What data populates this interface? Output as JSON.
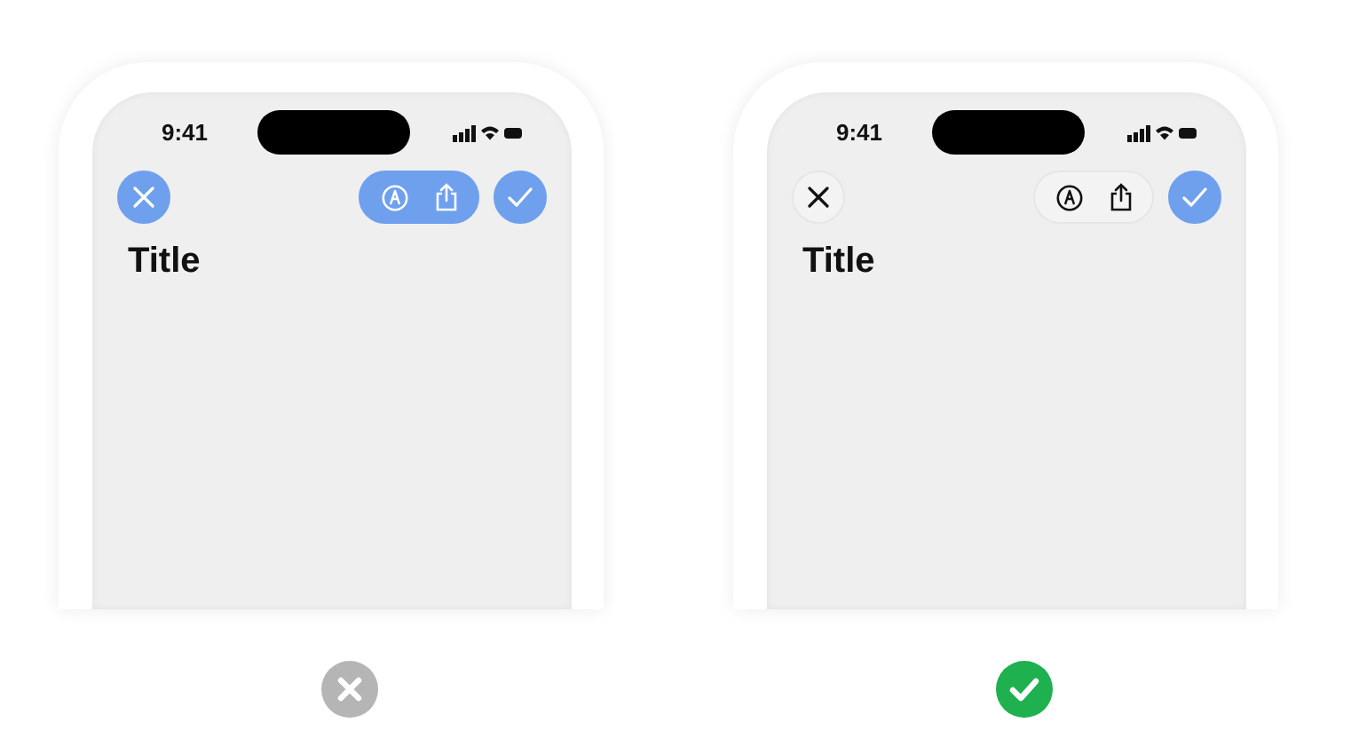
{
  "examples": [
    {
      "time": "9:41",
      "title": "Title",
      "buttons_tinted": true,
      "correct": false
    },
    {
      "time": "9:41",
      "title": "Title",
      "buttons_tinted": false,
      "correct": true
    }
  ]
}
